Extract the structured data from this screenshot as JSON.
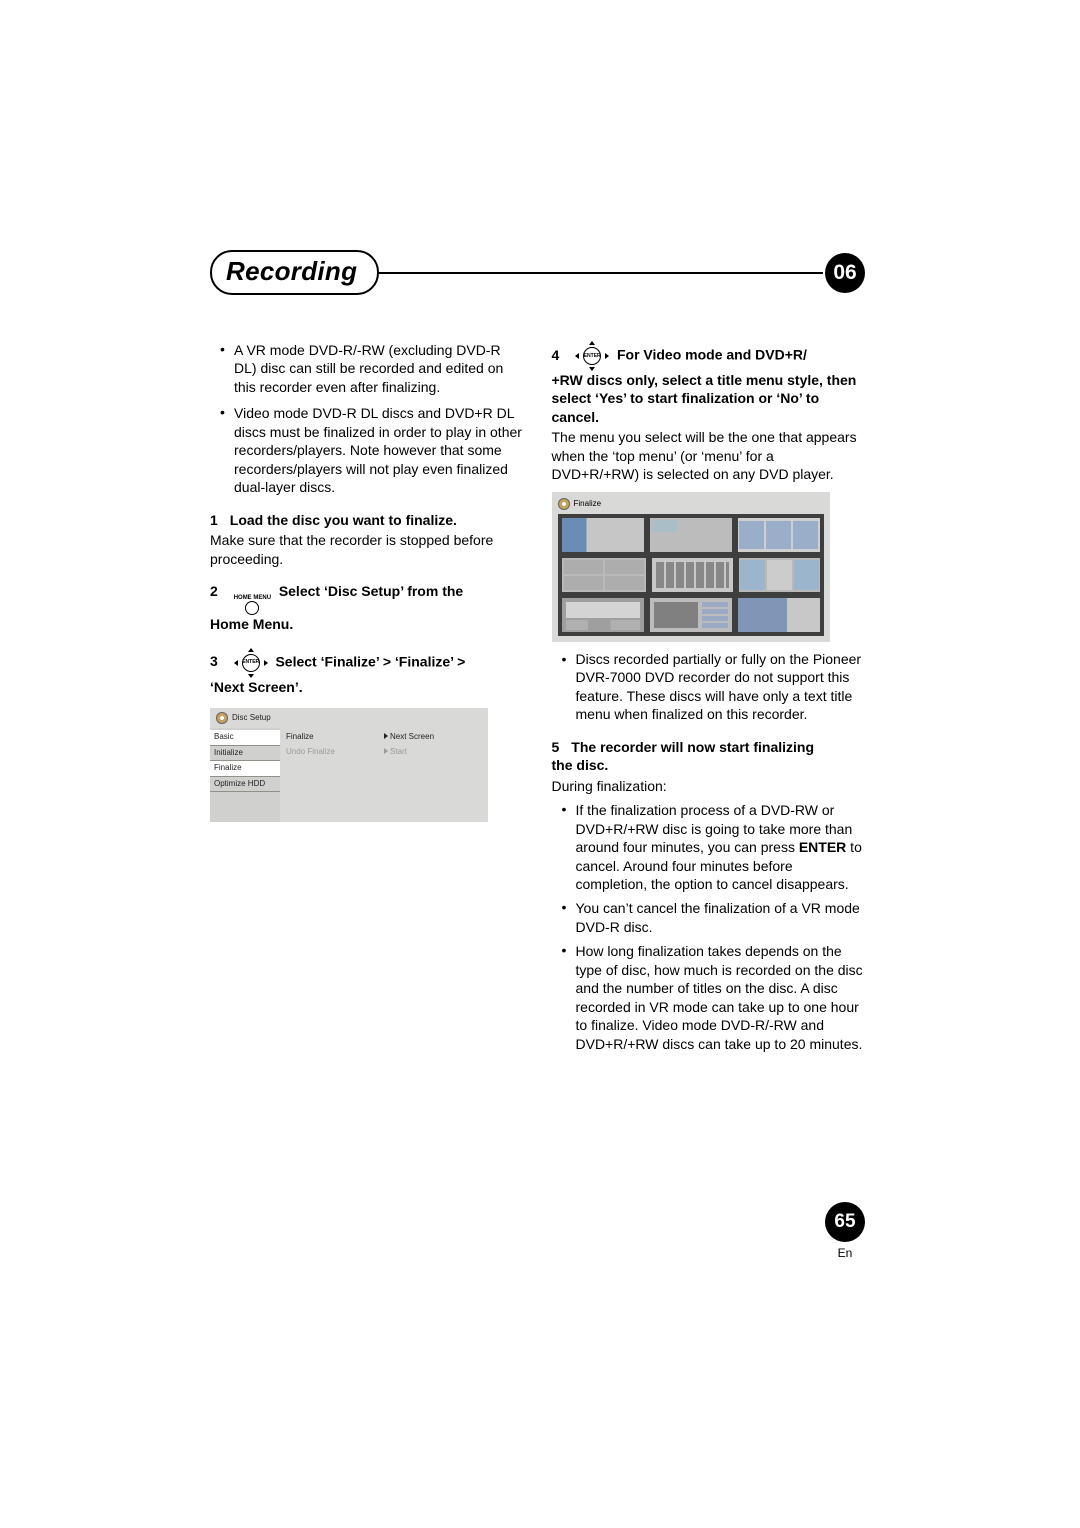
{
  "header": {
    "title": "Recording",
    "chapter": "06"
  },
  "left": {
    "intro_bullets": [
      "A VR mode DVD-R/-RW (excluding DVD-R DL) disc can still be recorded and edited on this recorder even after finalizing.",
      "Video mode DVD-R DL discs and DVD+R DL discs must be finalized in order to play in other recorders/players. Note however that some recorders/players will not play even finalized dual-layer discs."
    ],
    "step1": {
      "num": "1",
      "bold": "Load the disc you want to finalize.",
      "body": "Make sure that the recorder is stopped before proceeding."
    },
    "step2": {
      "num": "2",
      "icon_label": "HOME MENU",
      "bold_a": "Select ‘Disc Setup’ from the",
      "bold_b": "Home Menu."
    },
    "step3": {
      "num": "3",
      "icon_label": "ENTER",
      "bold_a": "Select ‘Finalize’ > ‘Finalize’ >",
      "bold_b": "‘Next Screen’."
    },
    "disc_setup": {
      "title": "Disc Setup",
      "left_items": [
        "Basic",
        "Initialize",
        "Finalize",
        "Optimize HDD"
      ],
      "mid_items": [
        "Finalize",
        "Undo Finalize"
      ],
      "right_items": [
        "Next Screen",
        "Start"
      ]
    }
  },
  "right": {
    "step4": {
      "num": "4",
      "icon_label": "ENTER",
      "bold_a": "For Video mode and DVD+R/",
      "bold_b": "+RW discs only, select a title menu style, then select ‘Yes’ to start finalization or ‘No’ to cancel.",
      "body": "The menu you select will be the one that appears when the ‘top menu’ (or ‘menu’ for a DVD+R/+RW) is selected on any DVD player."
    },
    "finalize_title": "Finalize",
    "post_thumb_bullet": "Discs recorded partially or fully on the Pioneer DVR-7000 DVD recorder do not support this feature. These discs will have only a text title menu when finalized on this recorder.",
    "step5": {
      "num": "5",
      "bold_a": "The recorder will now start finalizing",
      "bold_b": "the disc.",
      "body": "During finalization:"
    },
    "during_bullets": [
      {
        "pre": "If the finalization process of a DVD-RW or DVD+R/+RW disc is going to take more than around four minutes, you can press ",
        "strong": "ENTER",
        "post": " to cancel. Around four minutes before completion, the option to cancel disappears."
      },
      {
        "pre": "You can’t cancel the finalization of a VR mode DVD-R disc.",
        "strong": "",
        "post": ""
      },
      {
        "pre": "How long finalization takes depends on the type of disc, how much is recorded on the disc and the number of titles on the disc. A disc recorded in VR mode can take up to one hour to finalize. Video mode DVD-R/-RW and DVD+R/+RW discs can take up to 20 minutes.",
        "strong": "",
        "post": ""
      }
    ]
  },
  "footer": {
    "page": "65",
    "lang": "En"
  }
}
